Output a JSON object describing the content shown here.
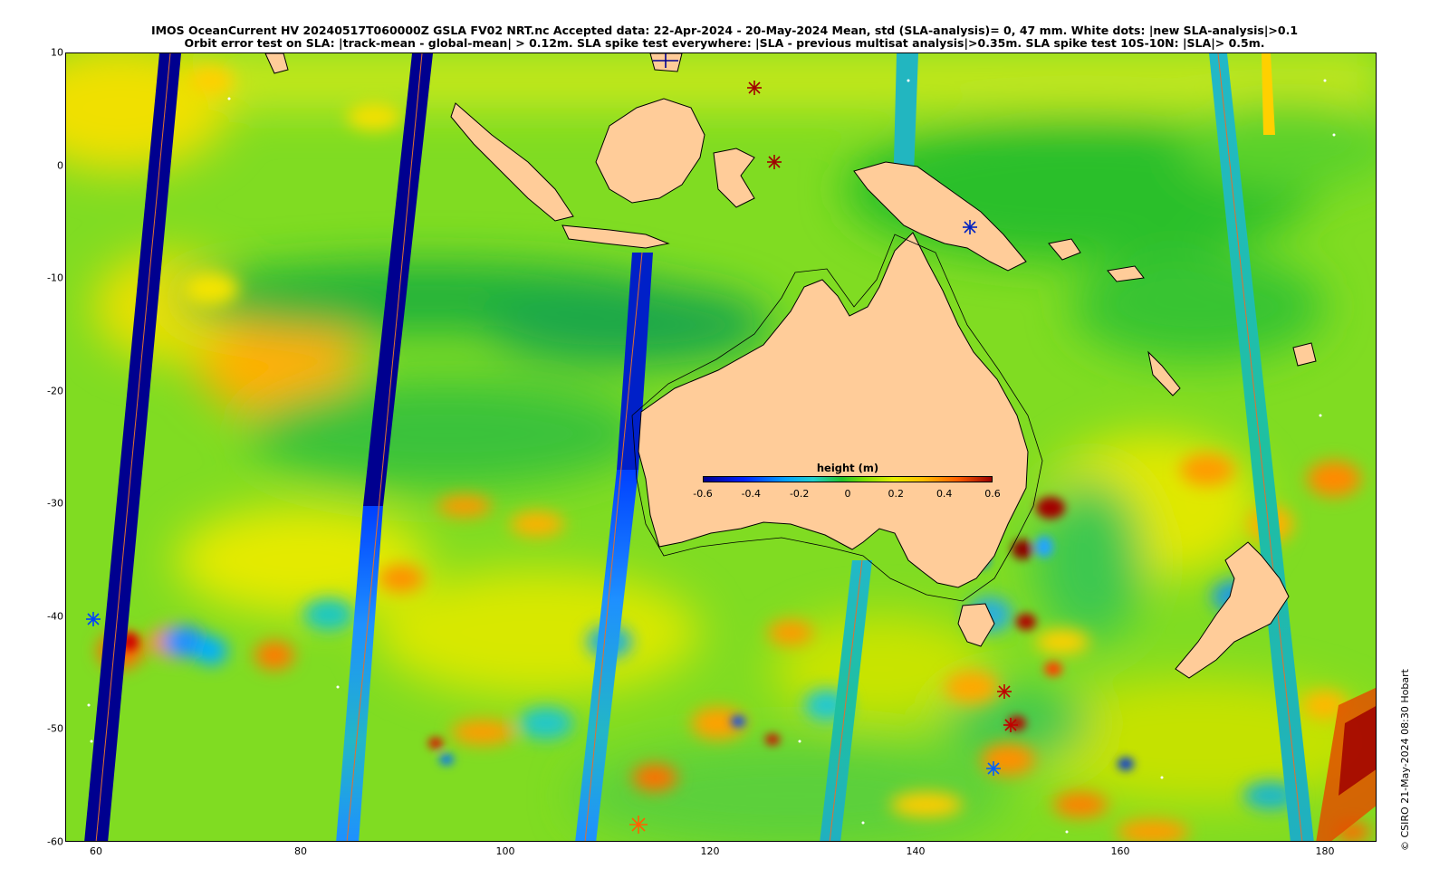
{
  "title": {
    "line1": "IMOS OceanCurrent HV 20240517T060000Z GSLA FV02 NRT.nc  Accepted data: 22-Apr-2024 - 20-May-2024 Mean, std (SLA-analysis)= 0, 47 mm. White dots: |new SLA-analysis|>0.1",
    "line2": "Orbit error test on SLA: |track-mean - global-mean| > 0.12m.  SLA spike test everywhere: |SLA - previous multisat analysis|>0.35m. SLA spike test 10S-10N: |SLA|> 0.5m."
  },
  "axes": {
    "x_ticks": [
      "60",
      "80",
      "100",
      "120",
      "140",
      "160",
      "180"
    ],
    "y_ticks": [
      "10",
      "0",
      "-10",
      "-20",
      "-30",
      "-40",
      "-50",
      "-60"
    ]
  },
  "colorbar": {
    "title": "height (m)",
    "ticks": [
      "-0.6",
      "-0.4",
      "-0.2",
      "0",
      "0.2",
      "0.4",
      "0.6"
    ]
  },
  "credit": "© CSIRO 21-May-2024 08:30 Hobart",
  "colors": {
    "land": "#ffcc99",
    "ocean_base": "#7ddc1f",
    "track_low": "#00008f",
    "track_mid": "#1e90ff",
    "track_cyan": "#23b6c6"
  }
}
